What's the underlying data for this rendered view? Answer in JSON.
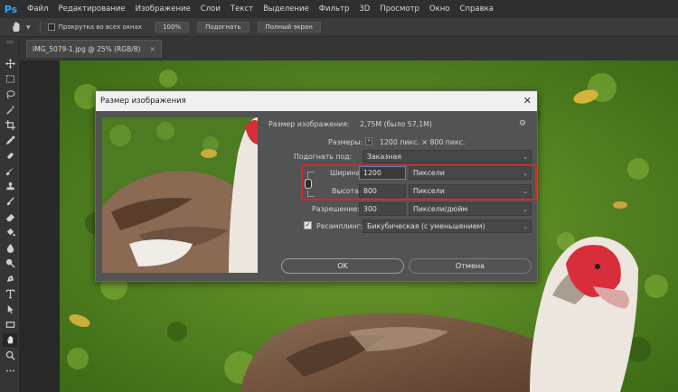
{
  "app": {
    "logo": "Ps"
  },
  "menu": [
    "Файл",
    "Редактирование",
    "Изображение",
    "Слои",
    "Текст",
    "Выделение",
    "Фильтр",
    "3D",
    "Просмотр",
    "Окно",
    "Справка"
  ],
  "options_bar": {
    "scroll_all_windows": "Прокрутка во всех окнах",
    "zoom_value": "100%",
    "fit_button": "Подогнать",
    "full_screen_button": "Полный экран"
  },
  "document_tab": {
    "title": "IMG_5079-1.jpg @ 25% (RGB/8)",
    "close": "×"
  },
  "tools": [
    "move-tool",
    "marquee-tool",
    "lasso-tool",
    "magic-wand-tool",
    "crop-tool",
    "eyedropper-tool",
    "healing-brush-tool",
    "brush-tool",
    "clone-stamp-tool",
    "history-brush-tool",
    "eraser-tool",
    "paint-bucket-tool",
    "blur-tool",
    "dodge-tool",
    "pen-tool",
    "type-tool",
    "path-selection-tool",
    "rectangle-tool",
    "hand-tool",
    "zoom-tool",
    "more-tools"
  ],
  "dialog": {
    "title": "Размер изображения",
    "close": "✕",
    "image_size_label": "Размер изображения:",
    "image_size_value": "2,75M (было 57,1M)",
    "dimensions_label": "Размеры:",
    "dimensions_value": "1200 пикс.  ×  800 пикс.",
    "fit_to_label": "Подогнать под:",
    "fit_to_value": "Заказная",
    "width_label": "Ширина:",
    "width_value": "1200",
    "width_unit": "Пиксели",
    "height_label": "Высота:",
    "height_value": "800",
    "height_unit": "Пиксели",
    "resolution_label": "Разрешение:",
    "resolution_value": "300",
    "resolution_unit": "Пиксели/дюйм",
    "resample_label": "Ресамплинг:",
    "resample_checked": true,
    "resample_value": "Бикубическая (с уменьшением)",
    "ok_button": "OK",
    "cancel_button": "Отмена"
  },
  "colors": {
    "highlight": "#d8262a",
    "focus_border": "#4a88c7",
    "ps_logo": "#31a8ff"
  }
}
